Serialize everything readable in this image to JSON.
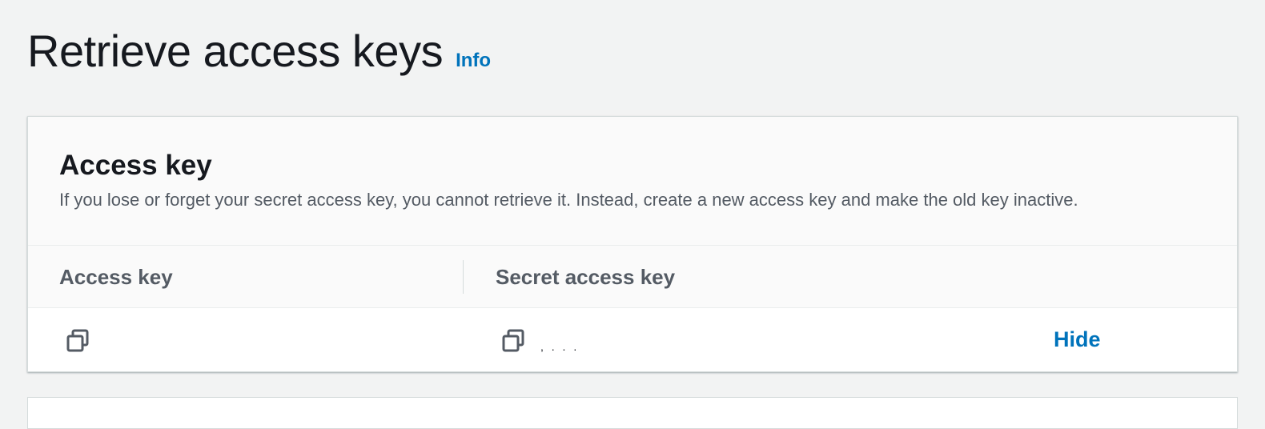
{
  "page": {
    "title": "Retrieve access keys",
    "info_label": "Info"
  },
  "access_key_panel": {
    "title": "Access key",
    "description": "If you lose or forget your secret access key, you cannot retrieve it. Instead, create a new access key and make the old key inactive.",
    "columns": [
      "Access key",
      "Secret access key"
    ],
    "row": {
      "access_key_value": "",
      "secret_key_value": ", .  .   .",
      "copy_icon": "copy-icon",
      "hide_label": "Hide"
    }
  },
  "colors": {
    "background": "#f2f3f3",
    "link": "#0073bb",
    "heading": "#16191f",
    "muted": "#545b64"
  }
}
